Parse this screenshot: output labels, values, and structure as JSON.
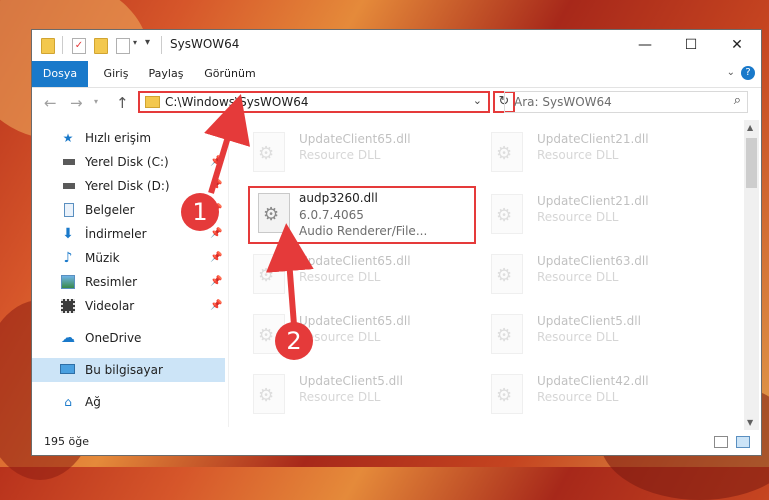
{
  "window": {
    "title": "SysWOW64",
    "controls": {
      "minimize": "—",
      "maximize": "☐",
      "close": "✕"
    }
  },
  "ribbon": {
    "tabs": [
      "Dosya",
      "Giriş",
      "Paylaş",
      "Görünüm"
    ]
  },
  "address": {
    "path": "C:\\Windows\\SysWOW64",
    "search_placeholder": "Ara: SysWOW64"
  },
  "sidebar": {
    "items": [
      {
        "label": "Hızlı erişim",
        "icon": "star-icon",
        "pinned": false,
        "selected": false
      },
      {
        "label": "Yerel Disk (C:)",
        "icon": "drive-icon",
        "pinned": true,
        "selected": false
      },
      {
        "label": "Yerel Disk (D:)",
        "icon": "drive-icon",
        "pinned": true,
        "selected": false
      },
      {
        "label": "Belgeler",
        "icon": "documents-icon",
        "pinned": true,
        "selected": false
      },
      {
        "label": "İndirmeler",
        "icon": "download-icon",
        "pinned": true,
        "selected": false
      },
      {
        "label": "Müzik",
        "icon": "music-icon",
        "pinned": true,
        "selected": false
      },
      {
        "label": "Resimler",
        "icon": "pictures-icon",
        "pinned": true,
        "selected": false
      },
      {
        "label": "Videolar",
        "icon": "videos-icon",
        "pinned": true,
        "selected": false
      },
      {
        "label": "OneDrive",
        "icon": "cloud-icon",
        "pinned": false,
        "selected": false
      },
      {
        "label": "Bu bilgisayar",
        "icon": "computer-icon",
        "pinned": false,
        "selected": true
      },
      {
        "label": "Ağ",
        "icon": "network-icon",
        "pinned": false,
        "selected": false
      }
    ]
  },
  "files": {
    "highlighted": {
      "name": "audp3260.dll",
      "version": "6.0.7.4065",
      "description": "Audio Renderer/File..."
    },
    "others": [
      {
        "name": "UpdateClient65.dll",
        "type": "Resource DLL"
      },
      {
        "name": "UpdateClient21.dll",
        "type": "Resource DLL"
      },
      {
        "name": "UpdateClient21.dll",
        "type": "Resource DLL"
      },
      {
        "name": "UpdateClient65.dll",
        "type": "Resource DLL"
      },
      {
        "name": "UpdateClient63.dll",
        "type": "Resource DLL"
      },
      {
        "name": "UpdateClient65.dll",
        "type": "Resource DLL"
      },
      {
        "name": "UpdateClient5.dll",
        "type": "Resource DLL"
      },
      {
        "name": "UpdateClient5.dll",
        "type": "Resource DLL"
      },
      {
        "name": "UpdateClient42.dll",
        "type": "Resource DLL"
      }
    ]
  },
  "status": {
    "count": "195 öğe"
  },
  "callouts": [
    "1",
    "2"
  ],
  "colors": {
    "accent": "#1979ca",
    "callout": "#e53a3a",
    "selection": "#cce4f7"
  }
}
